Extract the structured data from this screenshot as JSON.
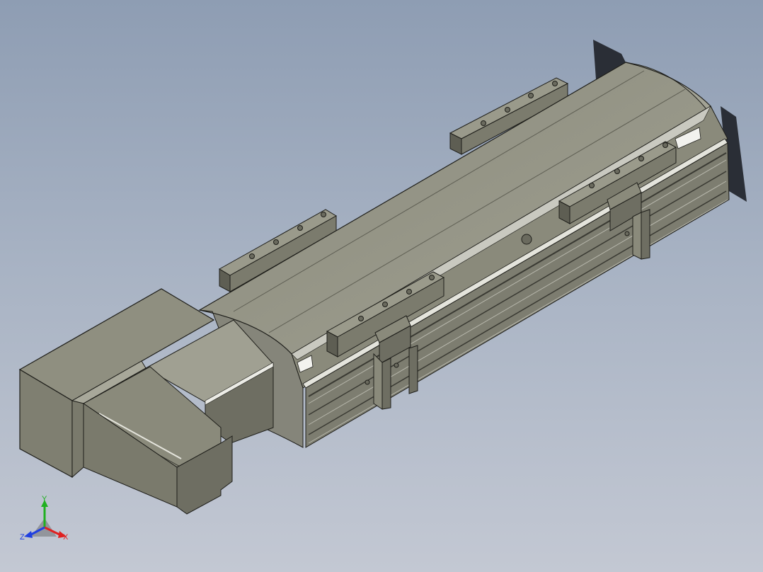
{
  "viewport": {
    "background_top": "#8e9db3",
    "background_bottom": "#c3c8d3"
  },
  "model": {
    "face_colors": {
      "top": "#8f8f80",
      "front": "#7f7f71",
      "side": "#6e6e62",
      "dark": "#4d4d44",
      "edge": "#1e1e1a",
      "highlight": "#e4e4dc"
    }
  },
  "triad": {
    "x_label": "X",
    "y_label": "Y",
    "z_label": "Z",
    "x_color": "#e02020",
    "y_color": "#20b020",
    "z_color": "#2040e0"
  }
}
